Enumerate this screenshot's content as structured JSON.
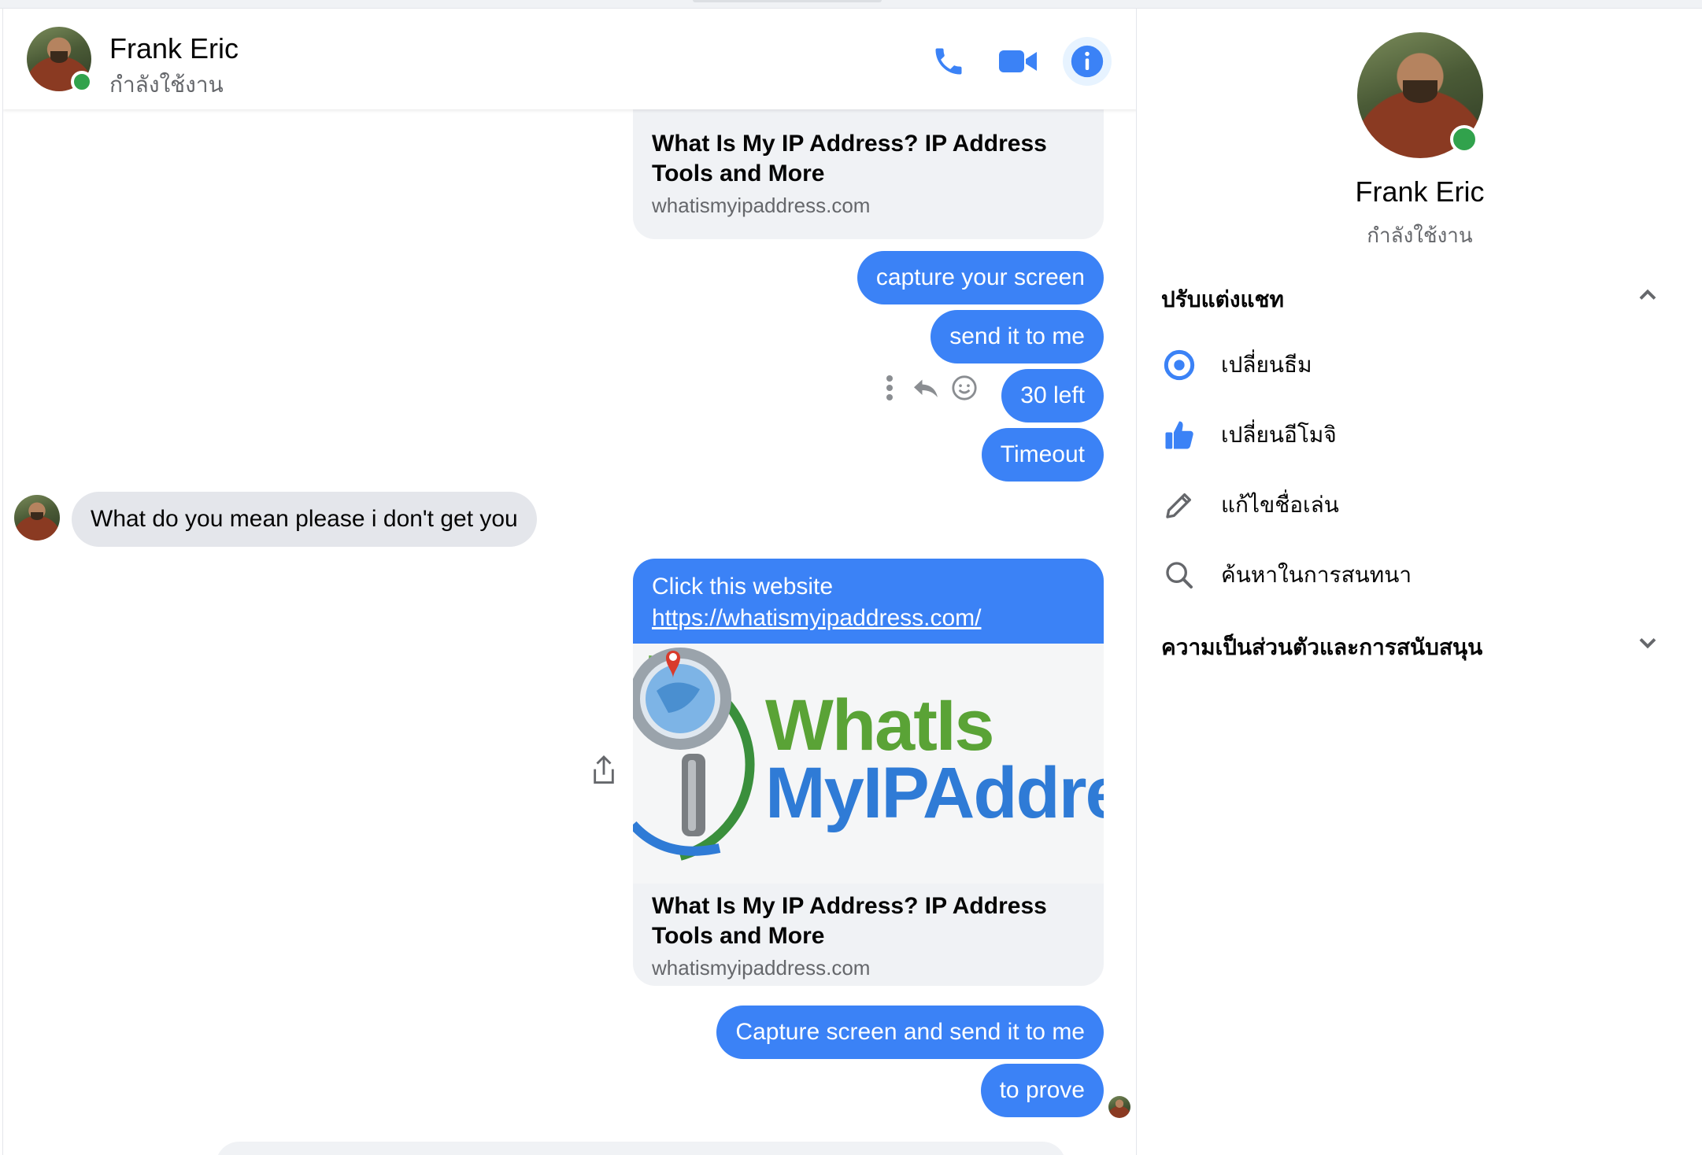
{
  "contact": {
    "name": "Frank Eric",
    "status": "กำลังใช้งาน"
  },
  "header": {
    "call_icon": "phone-icon",
    "video_icon": "video-camera-icon",
    "info_icon": "info-icon"
  },
  "messages": {
    "card1": {
      "title": "What Is My IP Address? IP Address Tools and More",
      "domain": "whatismyipaddress.com"
    },
    "out1": "capture your screen",
    "out2": "send it to me",
    "out3": "30 left",
    "out4": "Timeout",
    "in1": "What do you mean please i don't get you",
    "card2": {
      "text": "Click this website",
      "link": "https://whatismyipaddress.com/",
      "logo_line1": "WhatIs",
      "logo_line2": "MyIPAddre",
      "title": "What Is My IP Address? IP Address Tools and More",
      "domain": "whatismyipaddress.com"
    },
    "out5": "Capture screen and send it to me",
    "out6": "to prove"
  },
  "info_panel": {
    "name": "Frank Eric",
    "status": "กำลังใช้งาน",
    "customize_header": "ปรับแต่งแชท",
    "items": [
      {
        "label": "เปลี่ยนธีม",
        "icon": "theme-circle-icon"
      },
      {
        "label": "เปลี่ยนอีโมจิ",
        "icon": "thumbs-up-icon"
      },
      {
        "label": "แก้ไขชื่อเล่น",
        "icon": "pencil-icon"
      },
      {
        "label": "ค้นหาในการสนทนา",
        "icon": "search-icon"
      }
    ],
    "privacy_header": "ความเป็นส่วนตัวและการสนับสนุน"
  },
  "colors": {
    "accent": "#3b82f6",
    "online": "#31a24c",
    "incoming_bubble": "#e4e6eb",
    "card_bg": "#f0f2f5"
  }
}
